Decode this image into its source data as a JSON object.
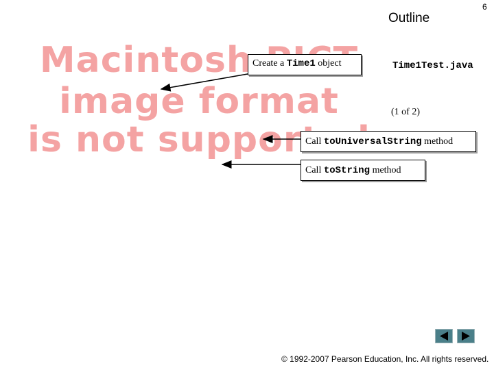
{
  "slide": {
    "page_number": "6",
    "outline_title": "Outline",
    "file_name": "Time1Test.java",
    "page_count": "(1 of 2)"
  },
  "placeholder_image": {
    "line1": "Macintosh PICT",
    "line2": "image format",
    "line3": "is not supported"
  },
  "callouts": [
    {
      "prefix": "Create a ",
      "code": "Time1",
      "suffix": " object"
    },
    {
      "prefix": "Call ",
      "code": "toUniversalString",
      "suffix": " method"
    },
    {
      "prefix": "Call ",
      "code": "toString",
      "suffix": " method"
    }
  ],
  "navigation": {
    "prev_icon": "triangle-left-icon",
    "next_icon": "triangle-right-icon",
    "color": "#4a7f89"
  },
  "footer": {
    "copyright": "© 1992-2007 Pearson Education, Inc.  All rights reserved."
  },
  "colors": {
    "placeholder_text": "#f4a3a3",
    "nav_button": "#4a7f89"
  }
}
